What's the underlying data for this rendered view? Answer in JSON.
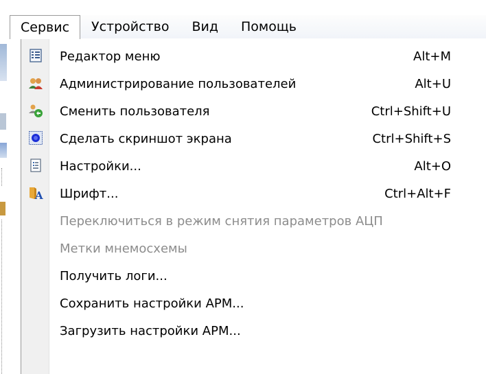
{
  "menubar": {
    "items": [
      {
        "label": "Сервис",
        "active": true
      },
      {
        "label": "Устройство",
        "active": false
      },
      {
        "label": "Вид",
        "active": false
      },
      {
        "label": "Помощь",
        "active": false
      }
    ]
  },
  "dropdown": {
    "items": [
      {
        "label": "Редактор меню",
        "shortcut": "Alt+M",
        "icon": "menu-editor-icon",
        "enabled": true
      },
      {
        "label": "Администрирование пользователей",
        "shortcut": "Alt+U",
        "icon": "users-icon",
        "enabled": true
      },
      {
        "label": "Сменить пользователя",
        "shortcut": "Ctrl+Shift+U",
        "icon": "switch-user-icon",
        "enabled": true
      },
      {
        "label": "Сделать скриншот экрана",
        "shortcut": "Ctrl+Shift+S",
        "icon": "screenshot-icon",
        "enabled": true
      },
      {
        "label": "Настройки...",
        "shortcut": "Alt+O",
        "icon": "settings-icon",
        "enabled": true
      },
      {
        "label": "Шрифт...",
        "shortcut": "Ctrl+Alt+F",
        "icon": "font-icon",
        "enabled": true
      },
      {
        "label": "Переключиться в режим снятия параметров АЦП",
        "shortcut": "",
        "icon": "",
        "enabled": false
      },
      {
        "label": "Метки мнемосхемы",
        "shortcut": "",
        "icon": "",
        "enabled": false
      },
      {
        "label": "Получить логи...",
        "shortcut": "",
        "icon": "",
        "enabled": true
      },
      {
        "label": "Сохранить настройки АРМ...",
        "shortcut": "",
        "icon": "",
        "enabled": true
      },
      {
        "label": "Загрузить настройки АРМ...",
        "shortcut": "",
        "icon": "",
        "enabled": true
      }
    ]
  }
}
